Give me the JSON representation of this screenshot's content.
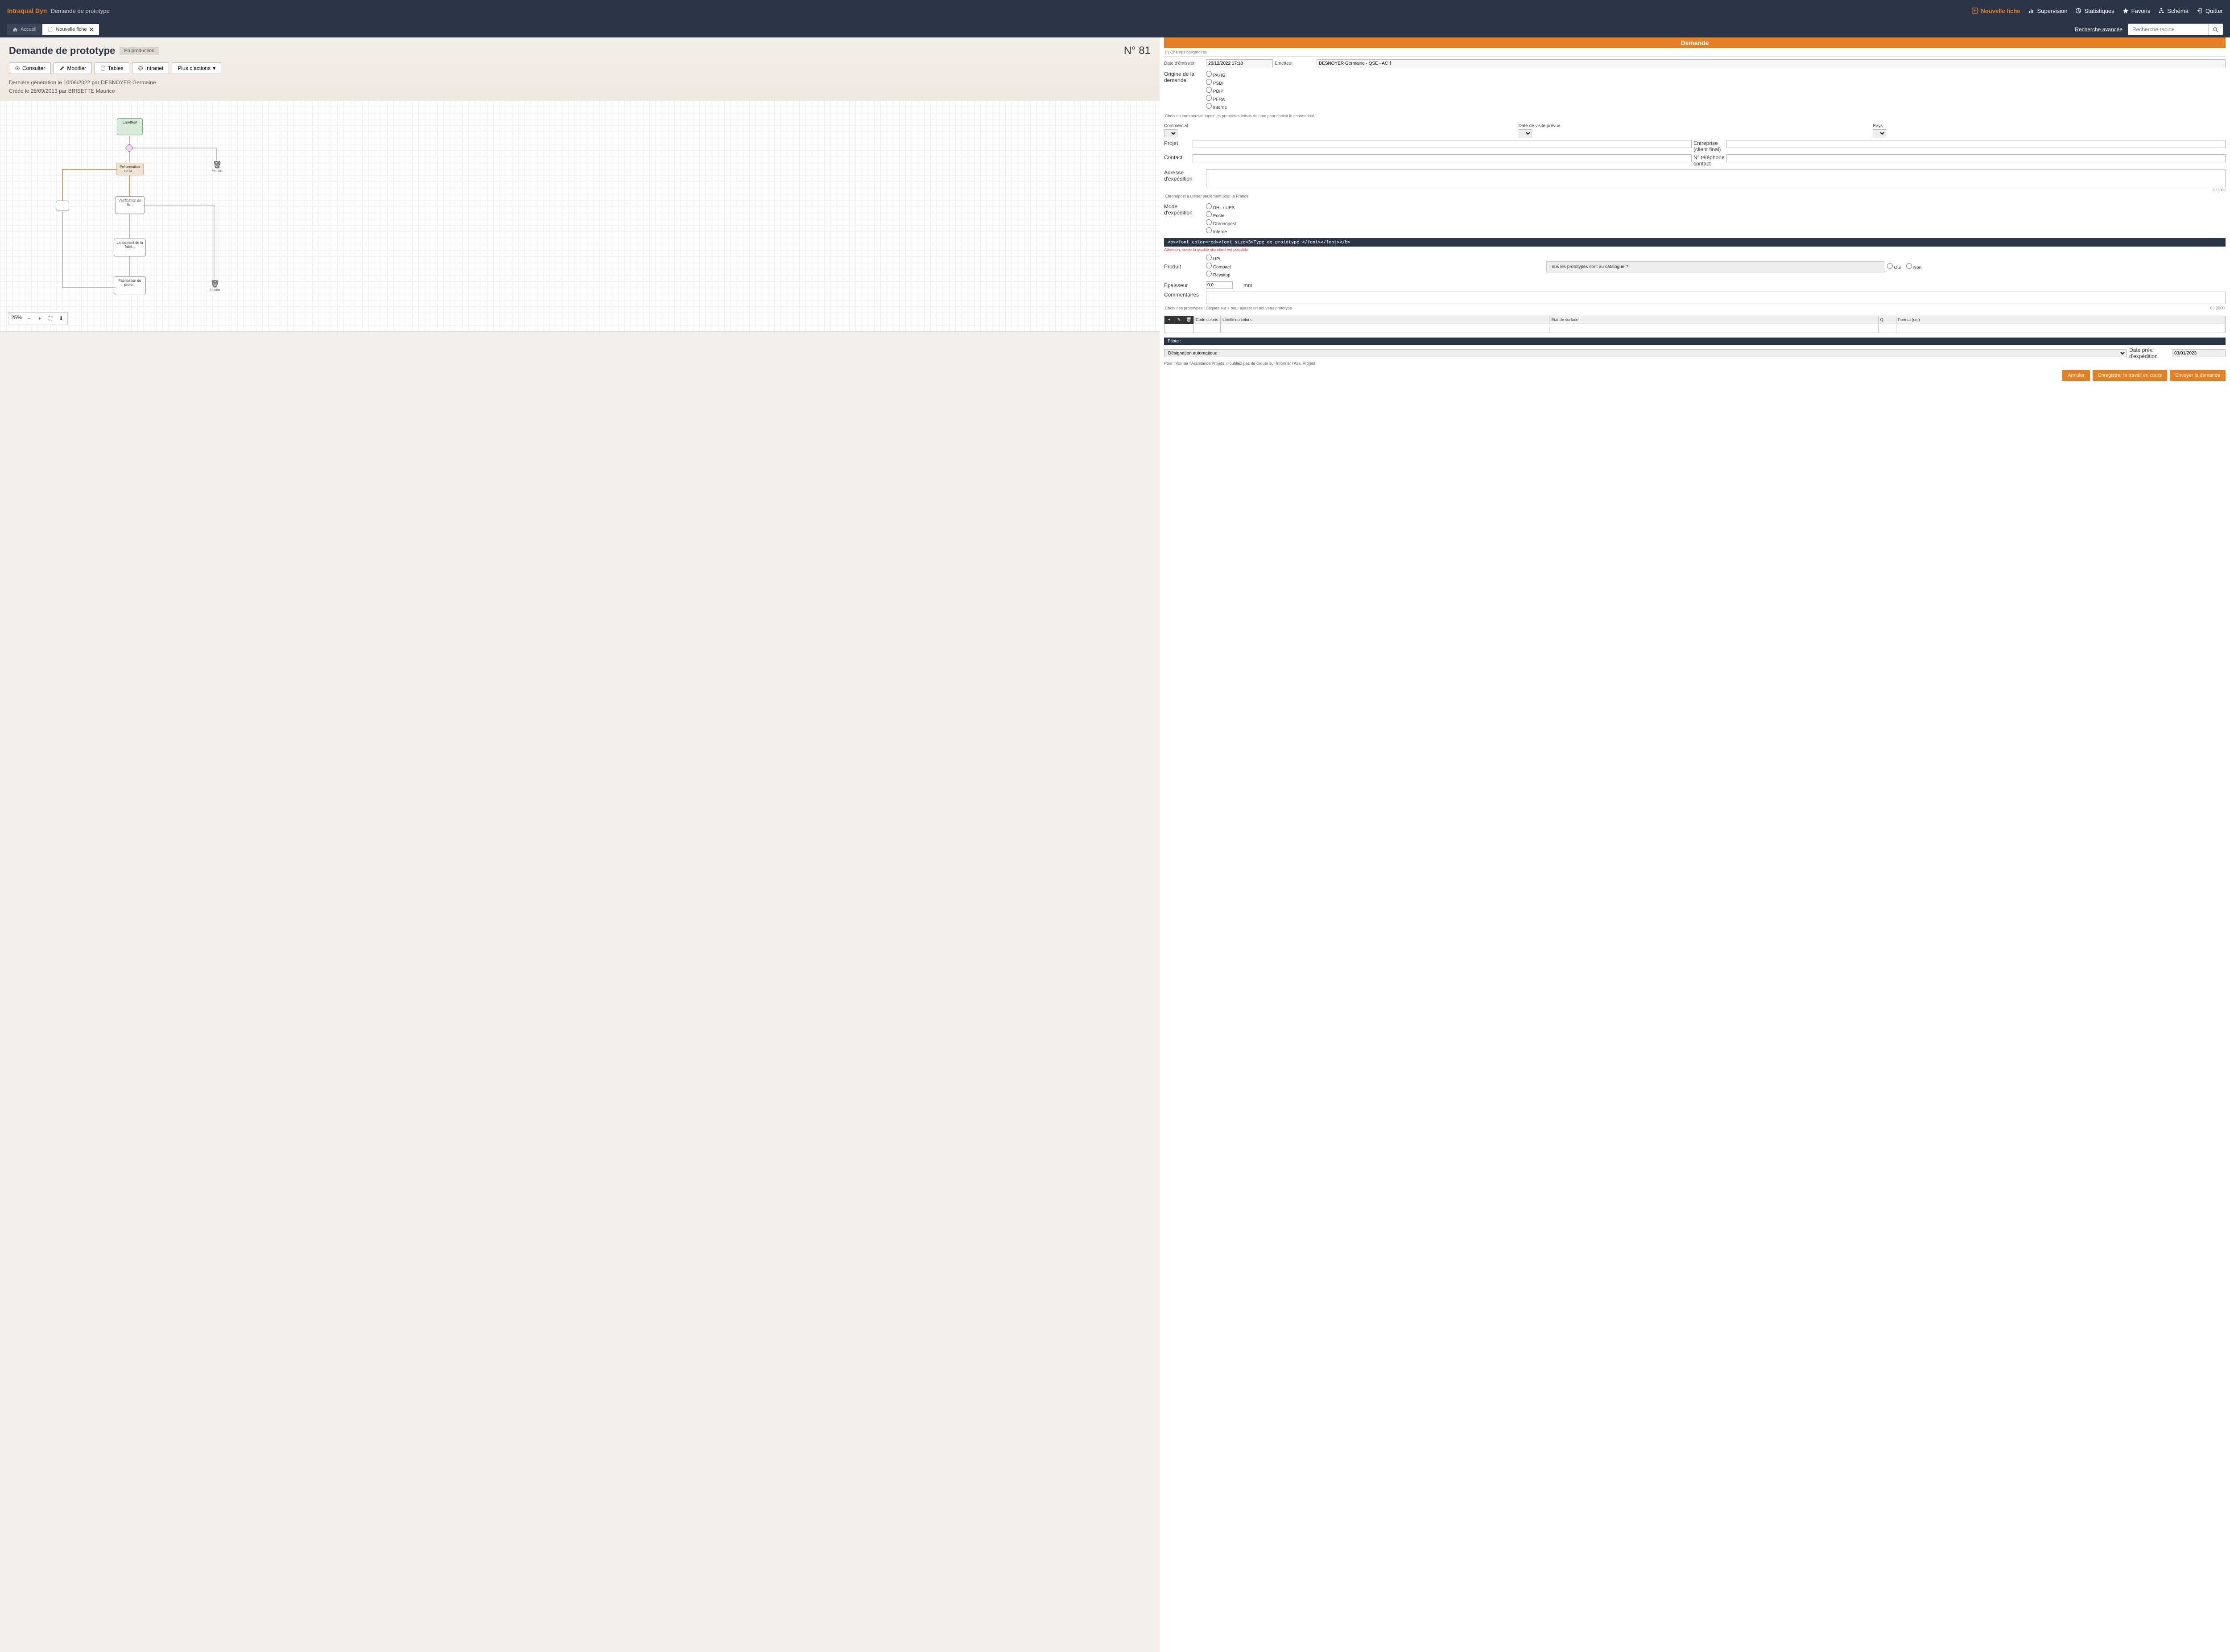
{
  "header": {
    "brand": "Intraqual Dyn",
    "brand_sub": "Demande de prototype",
    "nav": {
      "nouvelle": "Nouvelle fiche",
      "supervision": "Supervision",
      "statistiques": "Statistiques",
      "favoris": "Favoris",
      "schema": "Schéma",
      "quitter": "Quitter"
    }
  },
  "subheader": {
    "tab_home": "Accueil",
    "tab_active": "Nouvelle fiche",
    "search_advanced": "Recherche avancée",
    "search_placeholder": "Recherche rapide"
  },
  "doc": {
    "title": "Demande de prototype",
    "status": "En production",
    "number": "N° 81",
    "toolbar": {
      "consulter": "Consulter",
      "modifier": "Modifier",
      "tables": "Tables",
      "intranet": "Intranet",
      "plus": "Plus d'actions"
    },
    "meta1": "Dernière génération le 10/06/2022 par DESNOYER Germaine",
    "meta2": "Créée le 28/09/2013 par BRISETTE Maurice"
  },
  "diagram": {
    "zoom_level": "25%",
    "nodes": {
      "emetteur": "Emetteur",
      "pilote": "Présentation de la...",
      "verif": "Vérification de la...",
      "lancement": "Lancement de la fabri...",
      "fabrication": "Fabrication du proto..."
    },
    "bin_label": "Annuler"
  },
  "form": {
    "section_title": "Demande",
    "required_note": "(*) Champs obligatoires",
    "date_emission": {
      "label": "Date d'émission",
      "value": "26/12/2022 17:18"
    },
    "emetteur": {
      "label": "Emetteur",
      "value": "DESNOYER Germaine - QSE - AC ‡"
    },
    "origine": {
      "label": "Origine de la demande",
      "options": [
        "PAHG",
        "PSDI",
        "PDIP",
        "PFRA",
        "Interne"
      ]
    },
    "hint_commercial": "Choix du commercial; tapez les premières lettres du nom pour choisir le commercial.",
    "commercial_label": "Commercial",
    "date_visite_label": "Date de visite prévue",
    "pays_label": "Pays",
    "projet_label": "Projet",
    "contact_label": "Contact",
    "entreprise_label": "Entreprise (client final)",
    "telephone_label": "N° téléphone contact",
    "adresse_label": "Adresse d'expédition",
    "chronopost_note": "Chronopost à utiliser seulement pour la France",
    "counter_2000": "0 / 2000",
    "mode_label": "Mode d'expédition",
    "mode_options": [
      "DHL / UPS",
      "Poste",
      "Chronopost",
      "Interne"
    ],
    "proto_header_html": "<b><font color=red><font size=3>Type de prototype </font></font></b>",
    "proto_warning": "Attention, seule la qualité standard est possible",
    "produit_label": "Produit",
    "produit_options": [
      "HPL",
      "Compact",
      "Reysitop"
    ],
    "question_catalogue": "Tous les prototypes sont au catalogue ?",
    "oui": "Oui",
    "non": "Non",
    "epaisseur_label": "Épaisseur",
    "epaisseur_value": "0,0",
    "epaisseur_unit": "mm",
    "commentaires_label": "Commentaires",
    "proto_add_hint": "Choix des prototypes : Cliquez sur + pour ajouter un nouveau prototype",
    "table": {
      "code": "Code coloris",
      "libelle": "Libellé du coloris",
      "etat": "État de surface",
      "qte": "Q.",
      "format": "Format (cm)"
    },
    "pilote_label": "Pilote :",
    "pilote_select": "Désignation automatique",
    "date_prev_label": "Date prév. d'expédition",
    "date_prev_value": "03/01/2023",
    "pilot_note": "Pour informer l'Assistance Projets, n'oubliez pas de cliquer sur Informer l'Ass. Projets",
    "actions": {
      "annuler": "Annuler",
      "enregistrer": "Enregistrer le travail en cours",
      "envoyer": "Envoyer la demande"
    }
  }
}
